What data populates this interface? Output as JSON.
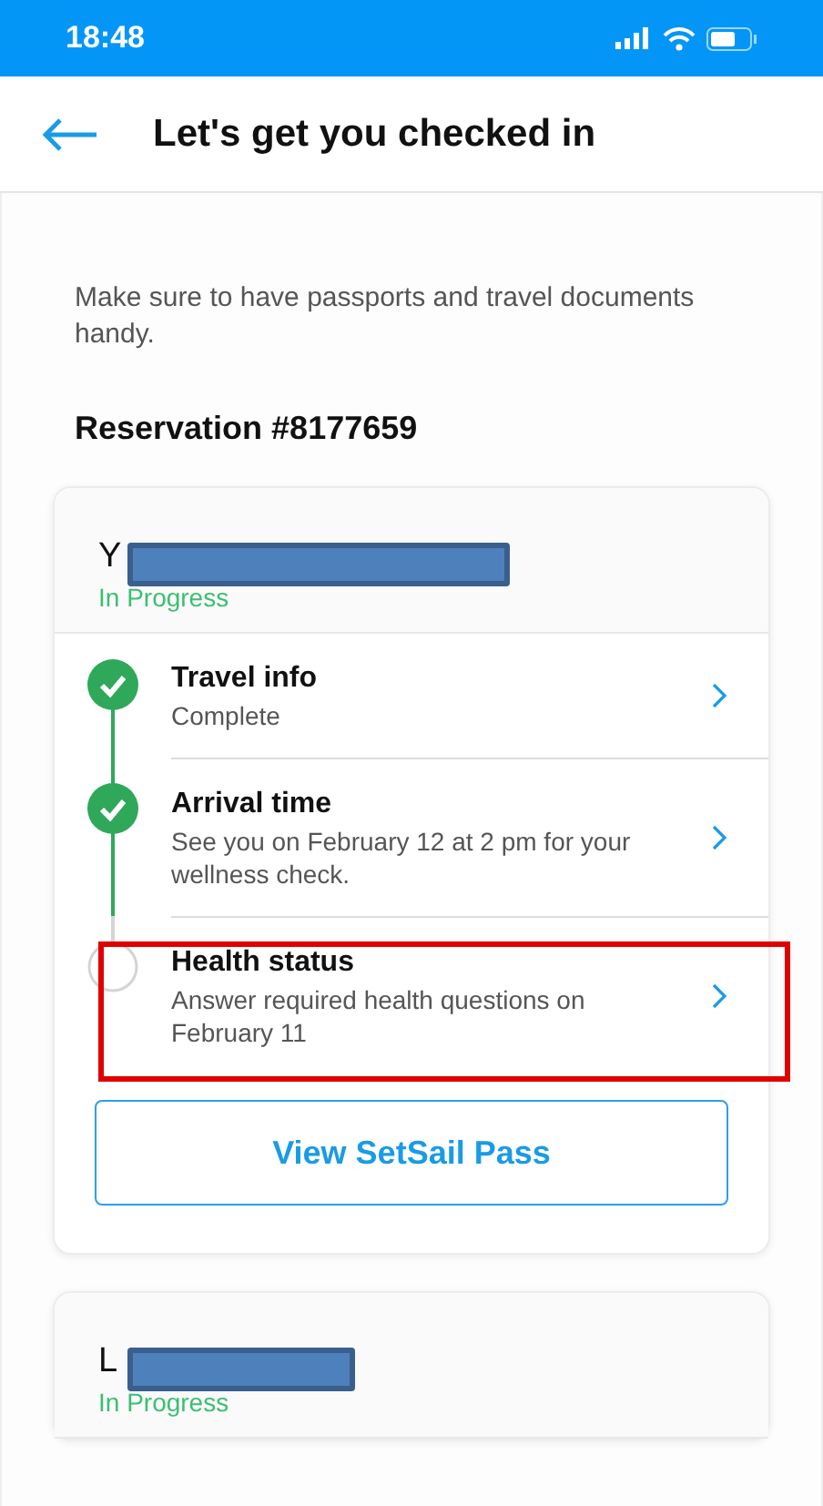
{
  "status_bar": {
    "time": "18:48"
  },
  "header": {
    "title": "Let's get you checked in"
  },
  "intro": "Make sure to have passports and travel documents handy.",
  "reservation": "Reservation #8177659",
  "guests": [
    {
      "name": "Y",
      "status": "In Progress",
      "redacted": true,
      "steps": [
        {
          "title": "Travel info",
          "subtitle": "Complete",
          "done": true,
          "highlighted": false
        },
        {
          "title": "Arrival time",
          "subtitle": "See you on February 12 at 2 pm for your wellness check.",
          "done": true,
          "highlighted": false
        },
        {
          "title": "Health status",
          "subtitle": "Answer required health questions on February 11",
          "done": false,
          "highlighted": true
        }
      ],
      "button": "View SetSail Pass"
    },
    {
      "name": "L",
      "status": "In Progress",
      "redacted": true
    }
  ]
}
